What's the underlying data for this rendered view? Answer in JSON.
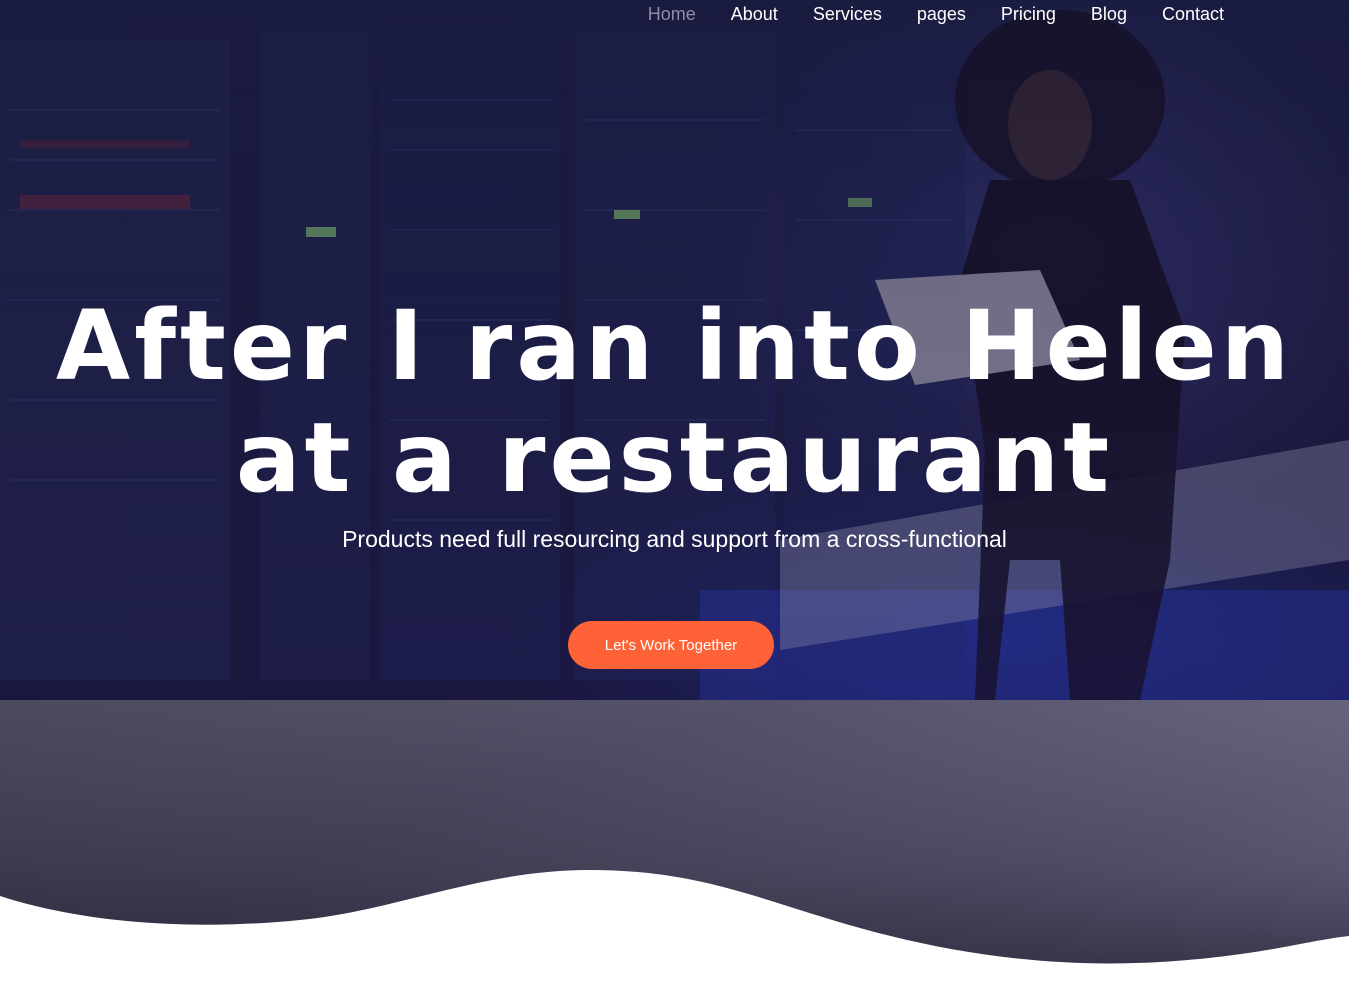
{
  "nav": {
    "items": [
      {
        "label": "Home",
        "active": true
      },
      {
        "label": "About",
        "active": false
      },
      {
        "label": "Services",
        "active": false
      },
      {
        "label": "pages",
        "active": false
      },
      {
        "label": "Pricing",
        "active": false
      },
      {
        "label": "Blog",
        "active": false
      },
      {
        "label": "Contact",
        "active": false
      }
    ]
  },
  "hero": {
    "headline_line1": "After I ran into Helen",
    "headline_line2": "at a restaurant",
    "subheadline": "Products need full resourcing and support from a cross-functional",
    "cta_label": "Let's Work Together",
    "background_image": "woman-with-laptop-in-server-room"
  },
  "colors": {
    "accent": "#ff6236",
    "nav_active": "#8f8aa8",
    "hero_overlay": "#1a1c3c",
    "text": "#ffffff"
  }
}
